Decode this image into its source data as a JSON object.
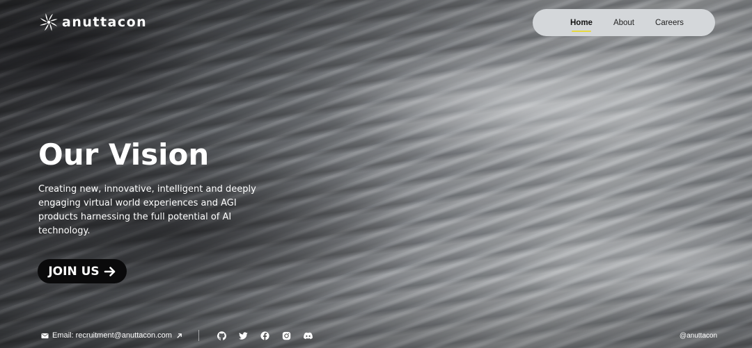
{
  "brand": {
    "name": "anuttacon"
  },
  "nav": {
    "items": [
      {
        "label": "Home",
        "active": true
      },
      {
        "label": "About",
        "active": false
      },
      {
        "label": "Careers",
        "active": false
      }
    ]
  },
  "hero": {
    "title": "Our Vision",
    "description": "Creating new, innovative, intelligent and deeply engaging virtual world experiences and AGI products harnessing the full potential of AI technology.",
    "cta_label": "JOIN US"
  },
  "footer": {
    "email_text": "Email: recruitment@anuttacon.com",
    "socials": [
      "github-icon",
      "twitter-icon",
      "facebook-icon",
      "instagram-icon",
      "discord-icon"
    ],
    "handle": "@anuttacon"
  },
  "colors": {
    "nav_bg": "#d4d7da",
    "nav_active_underline": "#e7d93e",
    "cta_bg": "#0a0a0b"
  }
}
